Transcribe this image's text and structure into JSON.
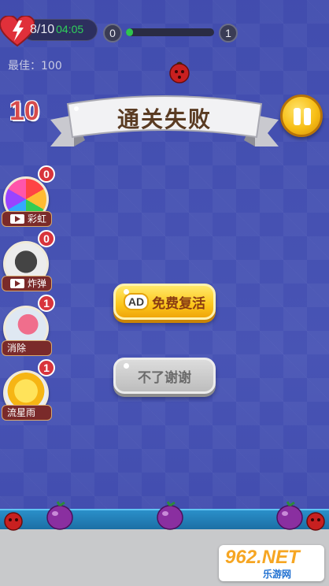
{
  "hud": {
    "lives": "8/10",
    "timer": "04:05",
    "level_start": "0",
    "level_end": "1",
    "progress": 0.08,
    "best_score": "最佳：100",
    "moves_left": "10"
  },
  "dialog": {
    "title": "通关失败",
    "revive_ad_label": "AD",
    "revive_label": "免费复活",
    "decline_label": "不了谢谢"
  },
  "powerups": [
    {
      "name": "彩虹",
      "count": "0",
      "has_video": true
    },
    {
      "name": "炸弹",
      "count": "0",
      "has_video": true
    },
    {
      "name": "消除",
      "count": "1",
      "has_video": false
    },
    {
      "name": "流星雨",
      "count": "1",
      "has_video": false
    }
  ],
  "watermark": {
    "brand": "962.NET",
    "sub": "乐游网"
  },
  "colors": {
    "background": "#4a56b6",
    "accent_yellow": "#fcc61b",
    "badge_red": "#d8343c",
    "progress_green": "#2ec44f"
  }
}
